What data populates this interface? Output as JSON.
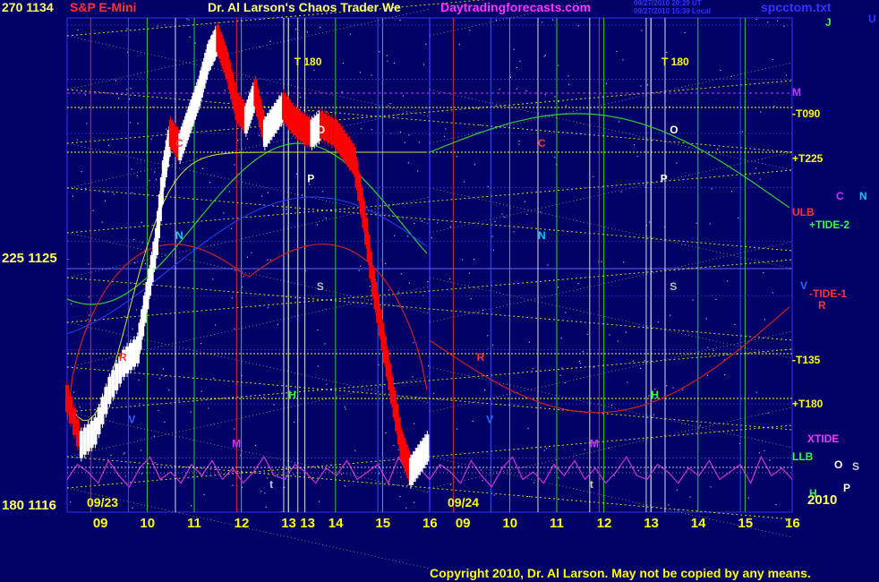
{
  "header": {
    "left_price": "270  1134",
    "symbol": "S&P E-Mini",
    "title": "Dr. Al Larson's Chaos Trader We",
    "website": "Daytradingforecasts.com",
    "stamp_line1": "09/27/2010 20:29 UT",
    "stamp_line2": "09/27/2010 15:39 Local",
    "filename": "spcctom.txt",
    "tr_j": "J",
    "tr_u": "U"
  },
  "axis_labels": {
    "mid_left": "225  1125",
    "bottom_left": "180  1116",
    "year": "2010"
  },
  "right_labels": [
    {
      "key": "m",
      "text": "M",
      "color": "#cc33ff"
    },
    {
      "key": "t090",
      "text": "-T090",
      "color": "#ffff00"
    },
    {
      "key": "t225",
      "text": "+T225",
      "color": "#ffff00"
    },
    {
      "key": "c",
      "text": "C",
      "color": "#cc33ff"
    },
    {
      "key": "n",
      "text": "N",
      "color": "#00ccff"
    },
    {
      "key": "ulb",
      "text": "ULB",
      "color": "#ff3333"
    },
    {
      "key": "tide2",
      "text": "+TIDE-2",
      "color": "#33ff33"
    },
    {
      "key": "v",
      "text": "V",
      "color": "#3366ff"
    },
    {
      "key": "tide1",
      "text": "-TIDE-1",
      "color": "#ff3333"
    },
    {
      "key": "r",
      "text": "R",
      "color": "#ff3333"
    },
    {
      "key": "t135",
      "text": "-T135",
      "color": "#ffff00"
    },
    {
      "key": "t180",
      "text": "+T180",
      "color": "#ffff00"
    },
    {
      "key": "xtide",
      "text": "XTIDE",
      "color": "#ff33ff"
    },
    {
      "key": "llb",
      "text": "LLB",
      "color": "#33ff33"
    },
    {
      "key": "o",
      "text": "O",
      "color": "#ffffff"
    },
    {
      "key": "s",
      "text": "S",
      "color": "#cccccc"
    },
    {
      "key": "p",
      "text": "P",
      "color": "#ffffff"
    },
    {
      "key": "h",
      "text": "H",
      "color": "#33ff33"
    }
  ],
  "copyright": "Copyright 2010, Dr. Al Larson. May not be copied by any means.",
  "colors": {
    "background": "#000066",
    "grid_green": "#33cc33",
    "grid_blue": "#3333ff",
    "price_white": "#ffffff",
    "price_red": "#ff0000",
    "yellow_lines": "#ffff00",
    "xtide": "#cc33cc"
  },
  "chart_data": {
    "type": "line",
    "title": "S&P E-Mini",
    "y_range": [
      1116,
      1134
    ],
    "y_ticks": [
      {
        "label": "1134",
        "value": 1134
      },
      {
        "label": "1125",
        "value": 1125
      },
      {
        "label": "1116",
        "value": 1116
      }
    ],
    "day_labels": [
      "09/23",
      "09/24"
    ],
    "x_ticks": [
      "09",
      "10",
      "11",
      "12",
      "13",
      "13",
      "14",
      "15",
      "16",
      "09",
      "10",
      "11",
      "12",
      "13",
      "14",
      "15",
      "16"
    ],
    "hour_range_per_day": [
      8.3,
      16.0
    ],
    "price_series": [
      {
        "name": "day1",
        "values": [
          [
            8.3,
            1120.2
          ],
          [
            8.6,
            1118.5
          ],
          [
            8.9,
            1119.0
          ],
          [
            9.2,
            1120.5
          ],
          [
            9.5,
            1121.5
          ],
          [
            9.8,
            1122.0
          ],
          [
            10.0,
            1124.0
          ],
          [
            10.2,
            1126.0
          ],
          [
            10.35,
            1128.5
          ],
          [
            10.5,
            1130.0
          ],
          [
            10.7,
            1129.5
          ],
          [
            10.9,
            1130.5
          ],
          [
            11.1,
            1131.5
          ],
          [
            11.3,
            1132.8
          ],
          [
            11.5,
            1133.5
          ],
          [
            11.7,
            1132.5
          ],
          [
            11.9,
            1131.0
          ],
          [
            12.1,
            1130.5
          ],
          [
            12.3,
            1131.5
          ],
          [
            12.5,
            1130.0
          ],
          [
            12.7,
            1130.5
          ],
          [
            12.9,
            1131.0
          ],
          [
            13.1,
            1130.5
          ],
          [
            13.3,
            1130.2
          ],
          [
            13.5,
            1130.0
          ],
          [
            13.7,
            1130.3
          ],
          [
            14.0,
            1130.0
          ],
          [
            14.2,
            1129.5
          ],
          [
            14.4,
            1129.0
          ],
          [
            14.6,
            1127.0
          ],
          [
            14.8,
            1124.5
          ],
          [
            15.0,
            1122.5
          ],
          [
            15.2,
            1120.5
          ],
          [
            15.4,
            1118.5
          ],
          [
            15.6,
            1117.5
          ],
          [
            15.8,
            1118.0
          ],
          [
            16.0,
            1118.5
          ]
        ]
      }
    ],
    "vertical_markers": [
      {
        "label": "T 180",
        "hour": 13.2,
        "day": 1
      },
      {
        "label": "T 180",
        "hour": 13.3,
        "day": 2
      }
    ],
    "event_letters_day1": [
      {
        "t": "R",
        "h": 9.4,
        "p": 1121.6
      },
      {
        "t": "V",
        "h": 9.6,
        "p": 1119.3
      },
      {
        "t": "C",
        "h": 10.6,
        "p": 1129.5
      },
      {
        "t": "N",
        "h": 10.6,
        "p": 1126.1
      },
      {
        "t": "M",
        "h": 11.8,
        "p": 1118.4
      },
      {
        "t": "O",
        "h": 13.6,
        "p": 1130.0
      },
      {
        "t": "P",
        "h": 13.4,
        "p": 1128.2
      },
      {
        "t": "S",
        "h": 13.6,
        "p": 1124.2
      },
      {
        "t": "H",
        "h": 13.0,
        "p": 1120.2
      },
      {
        "t": "t",
        "h": 12.6,
        "p": 1116.9
      }
    ],
    "event_letters_day2": [
      {
        "t": "R",
        "h": 9.3,
        "p": 1121.6
      },
      {
        "t": "V",
        "h": 9.5,
        "p": 1119.3
      },
      {
        "t": "C",
        "h": 10.6,
        "p": 1129.5
      },
      {
        "t": "N",
        "h": 10.6,
        "p": 1126.1
      },
      {
        "t": "M",
        "h": 11.7,
        "p": 1118.4
      },
      {
        "t": "O",
        "h": 13.4,
        "p": 1130.0
      },
      {
        "t": "P",
        "h": 13.2,
        "p": 1128.2
      },
      {
        "t": "S",
        "h": 13.4,
        "p": 1124.2
      },
      {
        "t": "H",
        "h": 13.0,
        "p": 1120.2
      },
      {
        "t": "t",
        "h": 11.7,
        "p": 1116.9
      }
    ],
    "xtide_series": {
      "name": "XTIDE",
      "values": [
        0.3,
        0.7,
        0.5,
        0.2,
        0.8,
        0.4,
        0.1,
        0.6,
        0.9,
        0.3,
        0.5,
        0.2,
        0.7,
        0.4,
        0.8,
        0.3,
        0.6,
        0.2,
        0.5,
        0.9,
        0.4,
        0.3,
        0.7,
        0.5,
        0.2,
        0.6,
        0.4,
        0.8,
        0.3,
        0.5,
        0.7,
        0.2,
        0.9,
        0.4,
        0.6,
        0.3
      ]
    },
    "grid": true
  }
}
